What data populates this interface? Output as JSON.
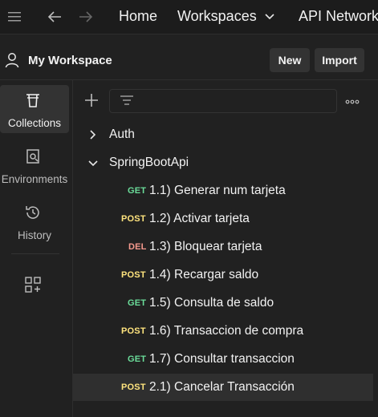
{
  "topbar": {
    "menu_icon": "hamburger-menu-icon",
    "back_icon": "arrow-left-icon",
    "forward_icon": "arrow-right-icon",
    "home_label": "Home",
    "workspaces_label": "Workspaces",
    "workspaces_chevron_icon": "chevron-down-icon",
    "api_network_label": "API Network"
  },
  "workspace": {
    "user_icon": "user-icon",
    "name": "My Workspace",
    "new_label": "New",
    "import_label": "Import"
  },
  "rail": {
    "items": [
      {
        "label": "Collections",
        "icon": "trash-collections-icon",
        "active": true
      },
      {
        "label": "Environments",
        "icon": "environment-icon",
        "active": false
      },
      {
        "label": "History",
        "icon": "history-icon",
        "active": false
      },
      {
        "label": "",
        "icon": "add-workbench-grid-icon",
        "active": false
      }
    ]
  },
  "toolbar": {
    "add_icon": "plus-icon",
    "filter_icon": "filter-lines-icon",
    "more_icon": "more-horizontal-icon",
    "search_value": ""
  },
  "tree": {
    "folders": [
      {
        "label": "Auth",
        "expanded": false
      },
      {
        "label": "SpringBootApi",
        "expanded": true
      }
    ],
    "requests": [
      {
        "method": "GET",
        "label": "1.1) Generar num tarjeta",
        "selected": false
      },
      {
        "method": "POST",
        "label": "1.2) Activar tarjeta",
        "selected": false
      },
      {
        "method": "DEL",
        "label": "1.3) Bloquear tarjeta",
        "selected": false
      },
      {
        "method": "POST",
        "label": "1.4) Recargar saldo",
        "selected": false
      },
      {
        "method": "GET",
        "label": "1.5) Consulta de saldo",
        "selected": false
      },
      {
        "method": "POST",
        "label": "1.6) Transaccion de compra",
        "selected": false
      },
      {
        "method": "GET",
        "label": "1.7) Consultar transaccion",
        "selected": false
      },
      {
        "method": "POST",
        "label": "2.1) Cancelar Transacción",
        "selected": true
      }
    ]
  },
  "colors": {
    "get": "#6bdd9a",
    "post": "#ffe47e",
    "del": "#f79a8e",
    "background": "#212121",
    "topbar": "#1c1c1c",
    "selected_row": "#2f2f2f"
  }
}
